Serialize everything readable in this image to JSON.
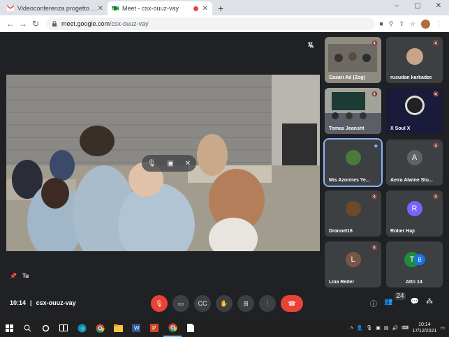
{
  "browser": {
    "tabs": [
      {
        "title": "Videoconferenza progetto intern",
        "active": false,
        "recording": false
      },
      {
        "title": "Meet - csx-ouuz-vay",
        "active": true,
        "recording": true
      }
    ],
    "new_tab": "+",
    "url_host": "meet.google.com",
    "url_path": "/csx-ouuz-vay"
  },
  "meeting": {
    "time": "10:14",
    "code": "csx-ouuz-vay",
    "self_label": "Tu",
    "participant_count": "24"
  },
  "tiles": [
    {
      "name": "Casari Ad (Zog)",
      "type": "video",
      "muted": true
    },
    {
      "name": "rusudan karkadze",
      "type": "video",
      "muted": true
    },
    {
      "name": "Tomas Jeansht",
      "type": "video",
      "muted": true
    },
    {
      "name": "X Soul X",
      "type": "video",
      "muted": true
    },
    {
      "name": "Mis Azorines Ye...",
      "type": "avatar",
      "initial": "",
      "color": "#4a7a3a",
      "muted": false,
      "speaking": true
    },
    {
      "name": "Aeira Alwine Stu...",
      "type": "avatar",
      "initial": "A",
      "color": "#5f6368",
      "muted": true
    },
    {
      "name": "Dranoel16",
      "type": "avatar",
      "initial": "",
      "color": "#6b4a2a",
      "muted": true
    },
    {
      "name": "Rober Haji",
      "type": "avatar",
      "initial": "R",
      "color": "#7b61ff",
      "muted": true
    },
    {
      "name": "Lina Reiter",
      "type": "avatar",
      "initial": "L",
      "color": "#795548",
      "muted": true
    },
    {
      "name": "Altri 14",
      "type": "others",
      "initial": "T",
      "color": "#1e8e3e",
      "muted": false
    }
  ],
  "taskbar": {
    "time": "10:14",
    "date": "17/12/2021"
  },
  "colors": {
    "bg": "#202124",
    "end_call": "#ea4335",
    "speaking_outline": "#8ab4f8"
  }
}
